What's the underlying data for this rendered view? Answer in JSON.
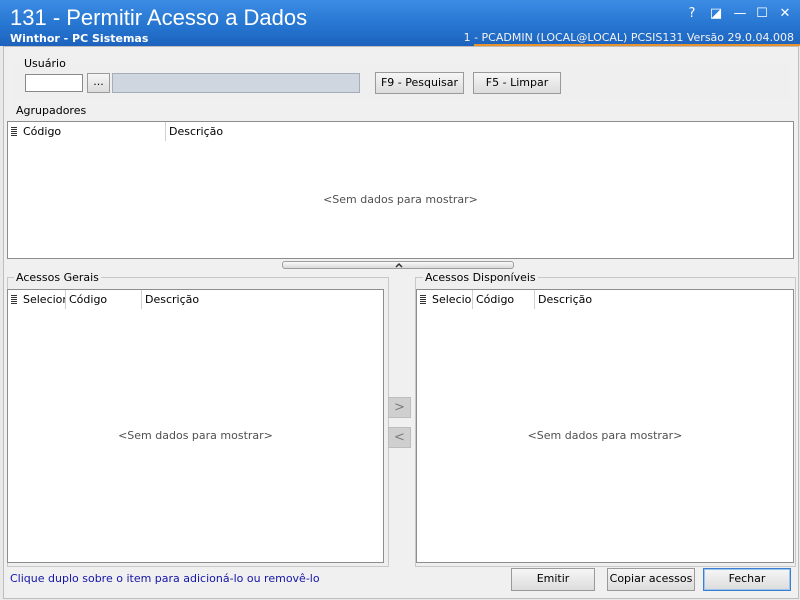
{
  "window": {
    "title": "131 - Permitir Acesso a Dados",
    "subtitle": "Winthor - PC Sistemas",
    "info": "1 - PCADMIN (LOCAL@LOCAL)   PCSIS131  Versão  29.0.04.008",
    "controls": {
      "help": "?",
      "restore": "◪",
      "minimize": "—",
      "maximize": "☐",
      "close": "✕"
    }
  },
  "usuario": {
    "label": "Usuário",
    "code_value": "",
    "lookup_button": "...",
    "name_value": "",
    "search_button": "F9 - Pesquisar",
    "clear_button": "F5 - Limpar"
  },
  "agrupadores": {
    "label": "Agrupadores",
    "columns": [
      "Código",
      "Descrição"
    ],
    "empty_text": "<Sem dados para mostrar>",
    "splitter_icon": "chevron-up-icon"
  },
  "acessos_gerais": {
    "label": "Acessos Gerais",
    "columns": [
      "Selecionar",
      "Código",
      "Descrição"
    ],
    "empty_text": "<Sem dados para mostrar>"
  },
  "acessos_disponiveis": {
    "label": "Acessos Disponíveis",
    "columns": [
      "Selecionar",
      "Código",
      "Descrição"
    ],
    "empty_text": "<Sem dados para mostrar>"
  },
  "transfer": {
    "add": ">",
    "remove": "<"
  },
  "footer": {
    "hint": "Clique duplo sobre o item para adicioná-lo ou removê-lo",
    "emitir": "Emitir",
    "copiar": "Copiar acessos",
    "fechar": "Fechar"
  },
  "colors": {
    "titlebar": "#2a7bd8",
    "accent_line": "#e8922e",
    "hint_text": "#1515a8"
  }
}
